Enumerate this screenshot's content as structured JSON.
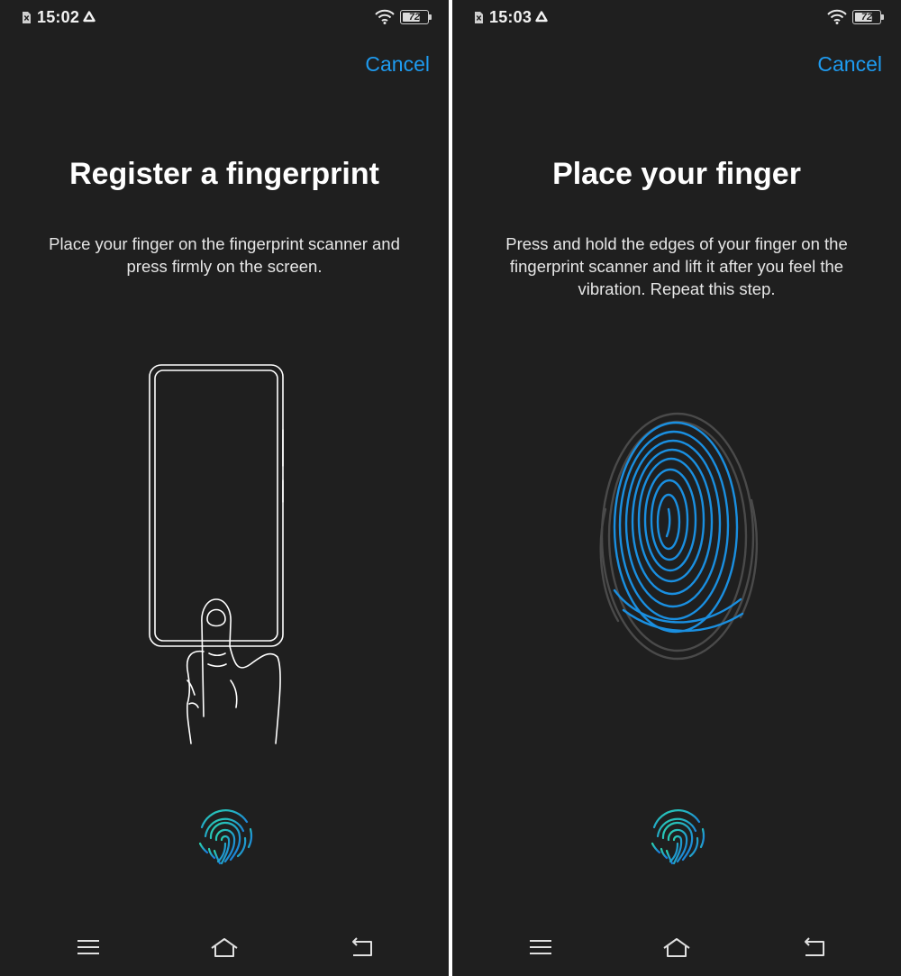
{
  "screens": [
    {
      "status_bar": {
        "time": "15:02",
        "battery": "72"
      },
      "cancel_label": "Cancel",
      "title": "Register a fingerprint",
      "description": "Place your finger on the fingerprint scanner and press firmly on the screen."
    },
    {
      "status_bar": {
        "time": "15:03",
        "battery": "72"
      },
      "cancel_label": "Cancel",
      "title": "Place your finger",
      "description": "Press and hold the edges of your finger on the fingerprint scanner and lift it after you feel the vibration. Repeat this step."
    }
  ],
  "battery_level": 0.72,
  "colors": {
    "background": "#1f1f1f",
    "accent": "#1e9bf0",
    "fingerprint_blue": "#1a8fe0",
    "fingerprint_grey": "#4a4a4a",
    "sensor_teal": "#1fc7b6"
  },
  "icons": {
    "status_left": [
      "no-sim-icon",
      "drive-icon"
    ],
    "status_right": [
      "wifi-icon",
      "battery-icon"
    ],
    "nav": [
      "menu-icon",
      "home-icon",
      "back-icon"
    ]
  }
}
